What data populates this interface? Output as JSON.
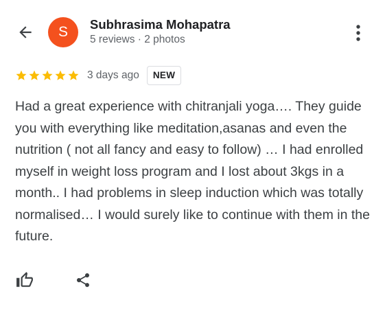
{
  "header": {
    "back_icon": "arrow-back-icon",
    "author_initial": "S",
    "author_name": "Subhrasima Mohapatra",
    "author_meta": "5 reviews · 2 photos",
    "more_icon": "more-vert-icon",
    "avatar_color": "#f4511e"
  },
  "review": {
    "rating": 5,
    "rating_max": 5,
    "star_color": "#fbbc04",
    "time": "3 days ago",
    "badge": "NEW",
    "text": "Had a great experience with chitranjali yoga…. They guide you with everything like meditation,asanas and even the nutrition ( not all fancy and easy to follow) … I had enrolled myself in weight loss program and I lost about 3kgs in a month.. I had problems in sleep induction which was totally normalised… I would surely like to continue with them in the future."
  },
  "actions": {
    "like_icon": "thumb-up-icon",
    "share_icon": "share-icon"
  }
}
